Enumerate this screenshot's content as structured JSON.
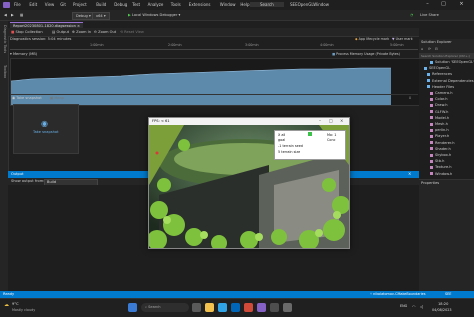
{
  "title_bar": {
    "menus": [
      "File",
      "Edit",
      "View",
      "Git",
      "Project",
      "Build",
      "Debug",
      "Test",
      "Analyze",
      "Tools",
      "Extensions",
      "Window",
      "Help"
    ],
    "search_label": "Search",
    "solution_name": "SEEOpenGLWindow",
    "live_share": "Live Share"
  },
  "toolbar": {
    "config": "Debug",
    "platform": "x64",
    "run_target": "Local Windows Debugger"
  },
  "left_strip": {
    "labels": [
      "Diagnostic Tools",
      "Toolbox"
    ]
  },
  "document_tab": {
    "label": "Report20230801-1820.diagsession"
  },
  "diagnostics": {
    "stop_collection": "Stop Collection",
    "output": "Output",
    "zoom_in": "Zoom In",
    "zoom_out": "Zoom Out",
    "reset_view": "Reset View",
    "session_text": "Diagnostics session: 5:04 minutes",
    "timeline_ticks": [
      "1:00min",
      "2:00min",
      "3:00min",
      "4:00min",
      "5:00min"
    ],
    "memory_label": "Memory (MB)",
    "legend": [
      {
        "label": "App lifecycle mark",
        "color": "#e8a33d"
      },
      {
        "label": "User mark",
        "color": "#c9b6e8"
      }
    ],
    "series_label": "Process Memory Usage (Private Bytes)",
    "y_axis_top": "341",
    "y_axis_right_top": "341.0",
    "y_axis_bottom": "0",
    "y_axis_right_bottom": "0",
    "take_snapshot": "Take snapshot",
    "heap_label": "Heap",
    "snapshot_card_label": "Take snapshot",
    "memory_area_color": "#6a9ec4"
  },
  "output_panel": {
    "title": "Output",
    "show_from_label": "Show output from:",
    "show_from_value": "Build"
  },
  "solution_explorer": {
    "title": "Solution Explorer",
    "search_placeholder": "Search Solution Explorer (Ctrl+;)",
    "items": [
      {
        "label": "Solution 'SEEOpenGL'"
      },
      {
        "label": "SEEOpenGL"
      },
      {
        "label": "References"
      },
      {
        "label": "External Dependencies"
      },
      {
        "label": "Header Files"
      },
      {
        "label": "Camera.h"
      },
      {
        "label": "Color.h"
      },
      {
        "label": "Draw.h"
      },
      {
        "label": "GLFW.h"
      },
      {
        "label": "Model.h"
      },
      {
        "label": "Mesh.h"
      },
      {
        "label": "perlin.h"
      },
      {
        "label": "Player.h"
      },
      {
        "label": "Renderer.h"
      },
      {
        "label": "Shader.h"
      },
      {
        "label": "Skybox.h"
      },
      {
        "label": "Stb.h"
      },
      {
        "label": "Texture.h"
      },
      {
        "label": "Window.h"
      }
    ],
    "properties_title": "Properties"
  },
  "status_bar": {
    "left": "Ready",
    "branch": "nikolatomov-CMakeBoundaries",
    "repo": "SEE"
  },
  "taskbar": {
    "weather_temp": "9°C",
    "weather_desc": "Mostly cloudy",
    "search": "Search",
    "lang": "ENG",
    "time": "18:20",
    "date": "04/08/2023"
  },
  "game_window": {
    "title": "FPS: < 61",
    "hud_line1": "X all",
    "hud_line2": "goal",
    "hud_line3": "-1  terrain seed",
    "hud_line4": "5  terrain size",
    "hud_right": "Mo: 1",
    "hud_right2": "Conc"
  }
}
